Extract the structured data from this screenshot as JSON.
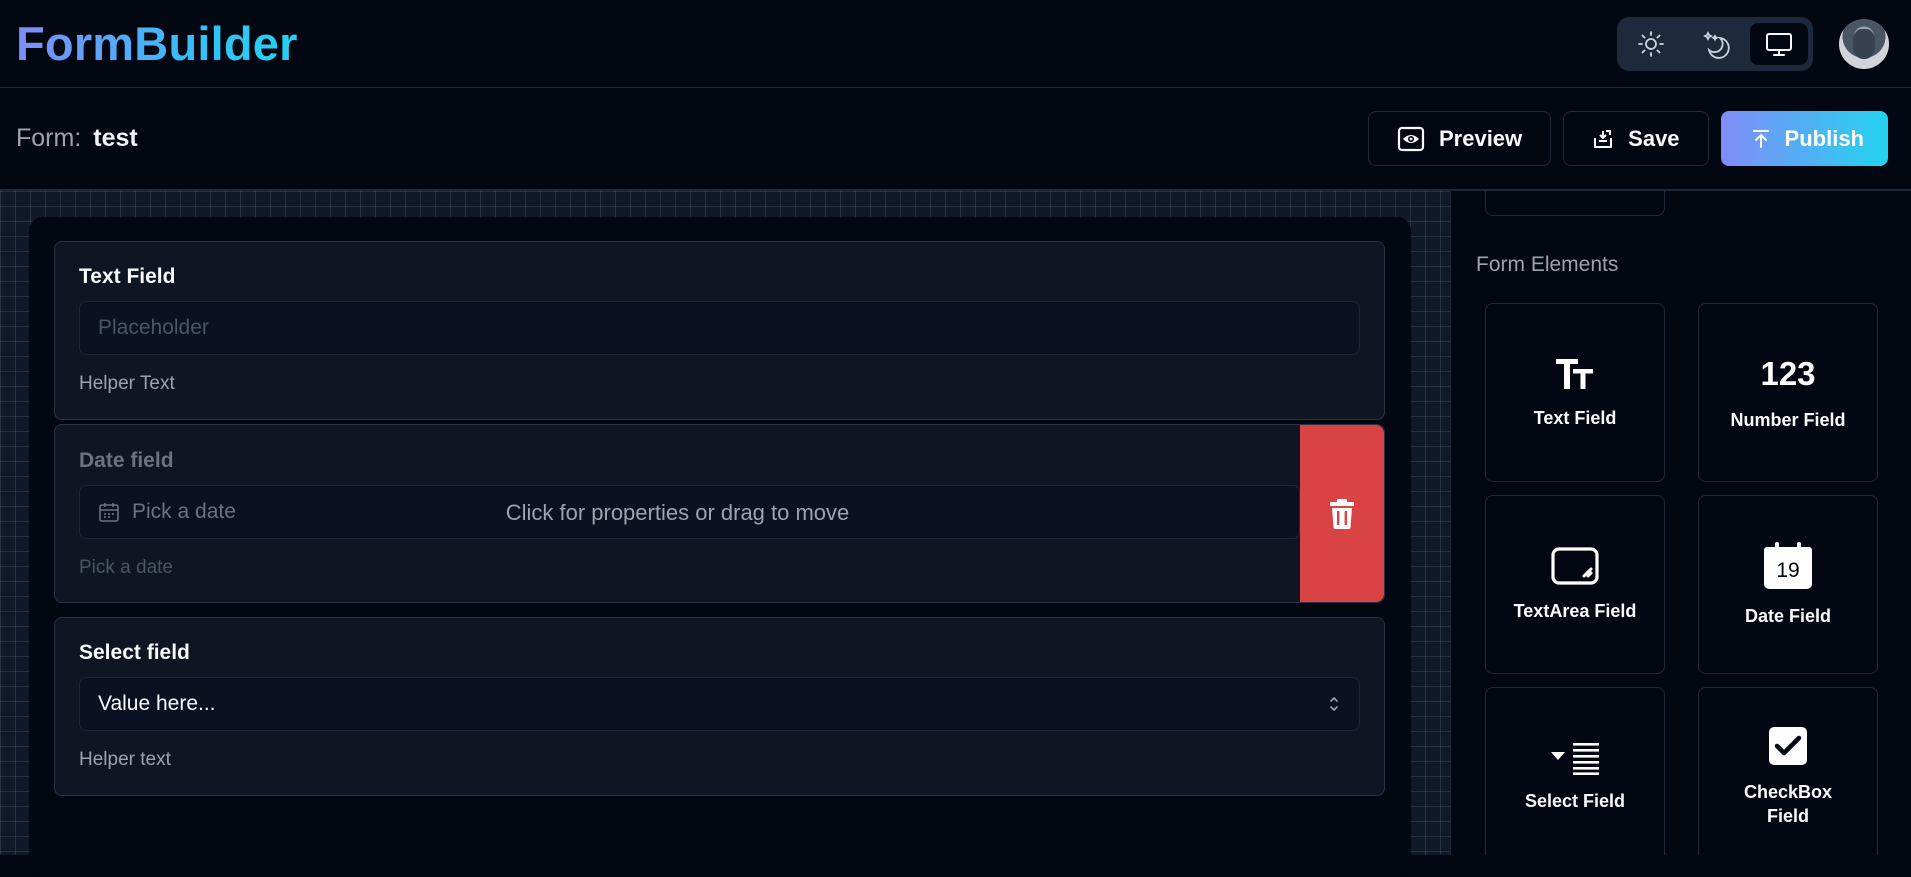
{
  "app": {
    "title": "FormBuilder",
    "theme_options": [
      "light",
      "dark",
      "system"
    ],
    "active_theme": "system",
    "brand_gradient": [
      "#818cf8",
      "#22d3ee"
    ]
  },
  "form": {
    "label": "Form:",
    "name": "test"
  },
  "toolbar": {
    "preview_label": "Preview",
    "save_label": "Save",
    "publish_label": "Publish"
  },
  "canvas": {
    "fields": [
      {
        "label": "Text Field",
        "placeholder": "Placeholder",
        "helper": "Helper Text"
      },
      {
        "label": "Date field",
        "placeholder": "Pick a date",
        "helper": "Pick a date",
        "hover_hint": "Click for properties or drag to move"
      },
      {
        "label": "Select field",
        "placeholder": "Value here...",
        "helper": "Helper text"
      }
    ],
    "delete_color": "#d94343"
  },
  "sidebar": {
    "section_title": "Form Elements",
    "elements": [
      {
        "label": "Text Field",
        "icon": "text-format-icon"
      },
      {
        "label": "Number Field",
        "icon": "number-icon",
        "icon_text": "123"
      },
      {
        "label": "TextArea Field",
        "icon": "textarea-icon"
      },
      {
        "label": "Date Field",
        "icon": "calendar-icon",
        "icon_text": "19"
      },
      {
        "label": "Select Field",
        "icon": "list-select-icon"
      },
      {
        "label": "CheckBox Field",
        "icon": "checkbox-icon"
      }
    ]
  }
}
